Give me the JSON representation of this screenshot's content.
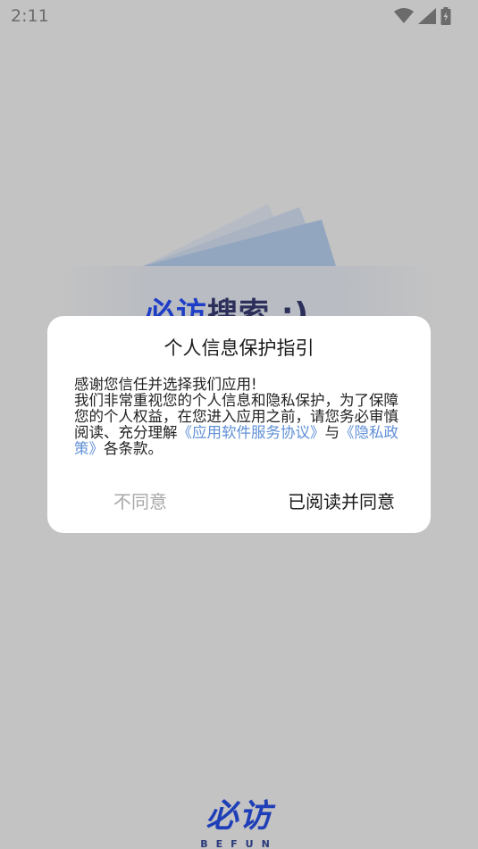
{
  "status_bar": {
    "time": "2:11",
    "icons": [
      "wifi-icon",
      "signal-icon",
      "battery-charging-icon"
    ]
  },
  "background": {
    "hero_title_part1": "必访",
    "hero_title_part2": "搜索 :)",
    "brand_logo": "必访",
    "brand_sub": "BEFUN"
  },
  "dialog": {
    "title": "个人信息保护指引",
    "body_line1": "感谢您信任并选择我们应用!",
    "body_line2": "我们非常重视您的个人信息和隐私保护，为了保障您的个人权益，在您进入应用之前，请您务必审慎阅读、充分理解",
    "link_terms": "《应用软件服务协议》",
    "body_and": "与",
    "link_privacy": "《隐私政策》",
    "body_tail": "各条款。",
    "disagree_label": "不同意",
    "agree_label": "已阅读并同意"
  },
  "colors": {
    "scrim": "#c3c3c3",
    "link": "#5f8fd6",
    "brand": "#1f3fb8"
  }
}
